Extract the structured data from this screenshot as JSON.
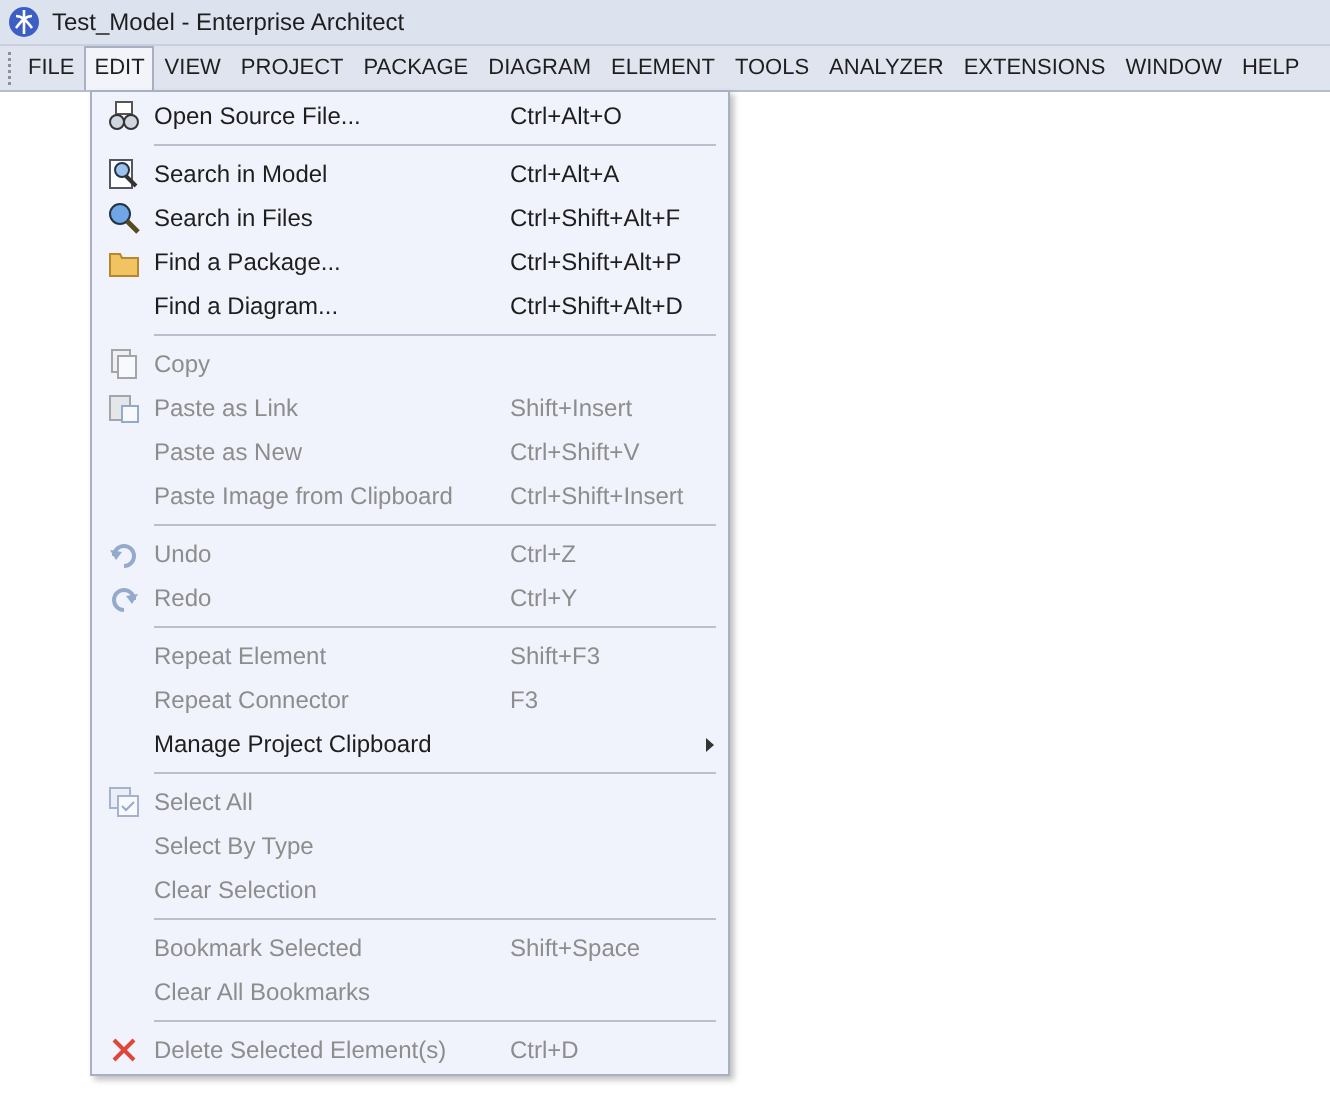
{
  "window": {
    "title": "Test_Model - Enterprise Architect"
  },
  "menubar": [
    {
      "label": "FILE",
      "selected": false
    },
    {
      "label": "EDIT",
      "selected": true
    },
    {
      "label": "VIEW",
      "selected": false
    },
    {
      "label": "PROJECT",
      "selected": false
    },
    {
      "label": "PACKAGE",
      "selected": false
    },
    {
      "label": "DIAGRAM",
      "selected": false
    },
    {
      "label": "ELEMENT",
      "selected": false
    },
    {
      "label": "TOOLS",
      "selected": false
    },
    {
      "label": "ANALYZER",
      "selected": false
    },
    {
      "label": "EXTENSIONS",
      "selected": false
    },
    {
      "label": "WINDOW",
      "selected": false
    },
    {
      "label": "HELP",
      "selected": false
    }
  ],
  "menu": [
    [
      {
        "label": "Open Source File...",
        "shortcut": "Ctrl+Alt+O",
        "disabled": false
      }
    ],
    [
      {
        "label": "Search in Model",
        "shortcut": "Ctrl+Alt+A",
        "disabled": false
      },
      {
        "label": "Search in Files",
        "shortcut": "Ctrl+Shift+Alt+F",
        "disabled": false
      },
      {
        "label": "Find a Package...",
        "shortcut": "Ctrl+Shift+Alt+P",
        "disabled": false
      },
      {
        "label": "Find a Diagram...",
        "shortcut": "Ctrl+Shift+Alt+D",
        "disabled": false
      }
    ],
    [
      {
        "label": "Copy",
        "disabled": true
      },
      {
        "label": "Paste as Link",
        "shortcut": "Shift+Insert",
        "disabled": true
      },
      {
        "label": "Paste as New",
        "shortcut": "Ctrl+Shift+V",
        "disabled": true
      },
      {
        "label": "Paste Image from Clipboard",
        "shortcut": "Ctrl+Shift+Insert",
        "disabled": true
      }
    ],
    [
      {
        "label": "Undo",
        "shortcut": "Ctrl+Z",
        "disabled": true
      },
      {
        "label": "Redo",
        "shortcut": "Ctrl+Y",
        "disabled": true
      }
    ],
    [
      {
        "label": "Repeat Element",
        "shortcut": "Shift+F3",
        "disabled": true
      },
      {
        "label": "Repeat Connector",
        "shortcut": "F3",
        "disabled": true
      },
      {
        "label": "Manage Project Clipboard",
        "disabled": false,
        "submenu": true
      }
    ],
    [
      {
        "label": "Select All",
        "disabled": true
      },
      {
        "label": "Select By Type",
        "disabled": true
      },
      {
        "label": "Clear Selection",
        "disabled": true
      }
    ],
    [
      {
        "label": "Bookmark Selected",
        "shortcut": "Shift+Space",
        "disabled": true
      },
      {
        "label": "Clear All Bookmarks",
        "disabled": true
      }
    ],
    [
      {
        "label": "Delete Selected Element(s)",
        "shortcut": "Ctrl+D",
        "disabled": true
      }
    ]
  ]
}
